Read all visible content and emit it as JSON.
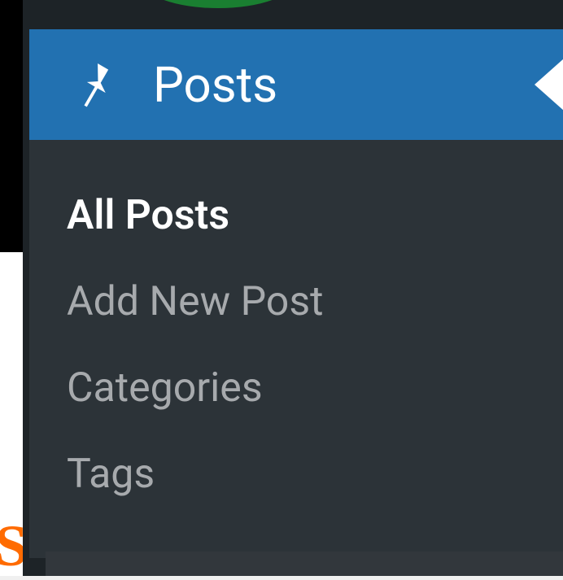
{
  "menu": {
    "header_label": "Posts",
    "items": [
      {
        "label": "All Posts",
        "active": true
      },
      {
        "label": "Add New Post",
        "active": false
      },
      {
        "label": "Categories",
        "active": false
      },
      {
        "label": "Tags",
        "active": false
      }
    ]
  },
  "partial_letter": "S"
}
